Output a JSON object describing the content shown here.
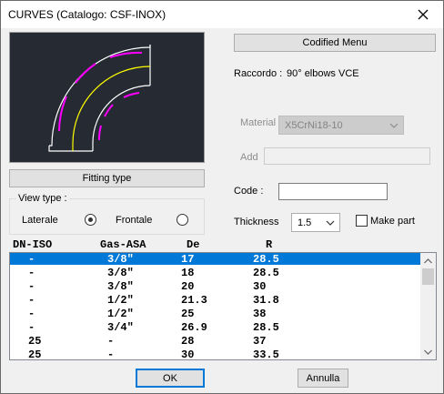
{
  "window": {
    "title": "CURVES (Catalogo: CSF-INOX)"
  },
  "buttons": {
    "codified_menu": "Codified Menu",
    "fitting_type": "Fitting type",
    "ok": "OK",
    "annulla": "Annulla"
  },
  "raccordo": {
    "label": "Raccordo :",
    "value": "90° elbows  VCE"
  },
  "material": {
    "label": "Material",
    "value": "X5CrNi18-10",
    "add_label": "Add",
    "add_value": ""
  },
  "code": {
    "label": "Code   :",
    "value": ""
  },
  "view_type": {
    "title": "View type  :",
    "laterale": "Laterale",
    "frontale": "Frontale",
    "selected": "Laterale"
  },
  "thickness": {
    "label": "Thickness",
    "value": "1.5"
  },
  "make_part": {
    "label": "Make part",
    "checked": false
  },
  "table": {
    "columns": [
      "DN-ISO",
      "Gas-ASA",
      "De",
      "R"
    ],
    "rows": [
      [
        "-",
        "3/8\"",
        "17",
        "28.5"
      ],
      [
        "-",
        "3/8\"",
        "18",
        "28.5"
      ],
      [
        "-",
        "3/8\"",
        "20",
        "30"
      ],
      [
        "-",
        "1/2\"",
        "21.3",
        "31.8"
      ],
      [
        "-",
        "1/2\"",
        "25",
        "38"
      ],
      [
        "-",
        "3/4\"",
        "26.9",
        "28.5"
      ],
      [
        "25",
        "-",
        "28",
        "37"
      ],
      [
        "25",
        "-",
        "30",
        "33.5"
      ]
    ],
    "selected_row": 0
  },
  "icons": {
    "close": "close-icon",
    "dropdown": "chevron-down-icon",
    "scroll_up": "arrow-up-icon",
    "scroll_down": "arrow-down-icon"
  },
  "colors": {
    "preview_bg": "#252a33",
    "elbow_outline": "#ffffff",
    "elbow_centerline": "#ffff00",
    "elbow_marks": "#ff00ff",
    "selection": "#0078d7"
  }
}
